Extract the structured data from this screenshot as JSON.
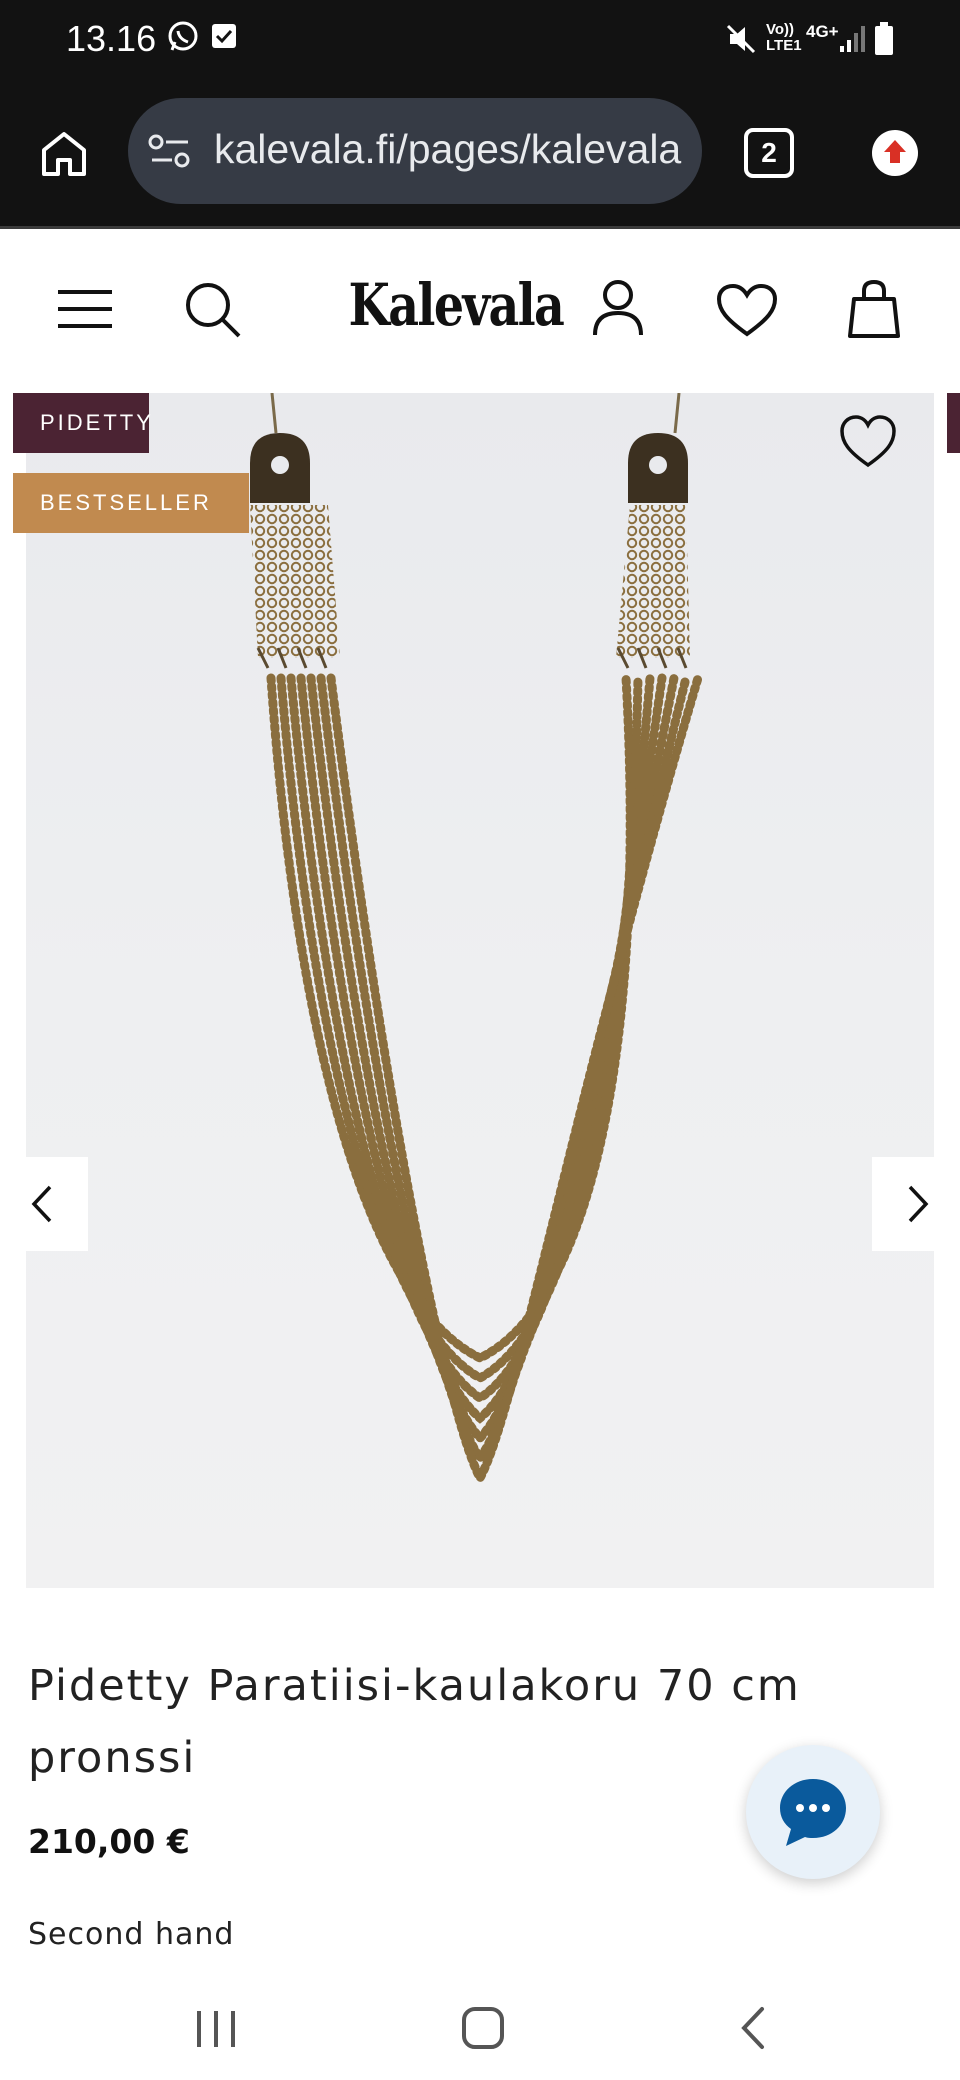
{
  "status_bar": {
    "time": "13.16",
    "icons": [
      "whatsapp-icon",
      "check-box-icon",
      "mute-icon",
      "volte-icon",
      "signal-icon",
      "battery-icon"
    ],
    "volte_label": "Vo)) LTE1",
    "network_label": "4G+"
  },
  "browser": {
    "url": "kalevala.fi/pages/kalevala",
    "tab_count": "2",
    "icons": [
      "home-icon",
      "site-settings-icon",
      "update-icon"
    ]
  },
  "site_header": {
    "logo": "Kalevala",
    "icons": [
      "menu-icon",
      "search-icon",
      "account-icon",
      "wishlist-icon",
      "cart-icon"
    ]
  },
  "product": {
    "badges": [
      "PIDETTY",
      "BESTSELLER"
    ],
    "title": "Pidetty Paratiisi-kaulakoru 70 cm pronssi",
    "price": "210,00 €",
    "condition": "Second hand"
  },
  "colors": {
    "badge_pidetty": "#4b2333",
    "badge_bestseller": "#c18a4f",
    "chat_accent": "#0a5a9c",
    "browser_dark": "#121212"
  }
}
